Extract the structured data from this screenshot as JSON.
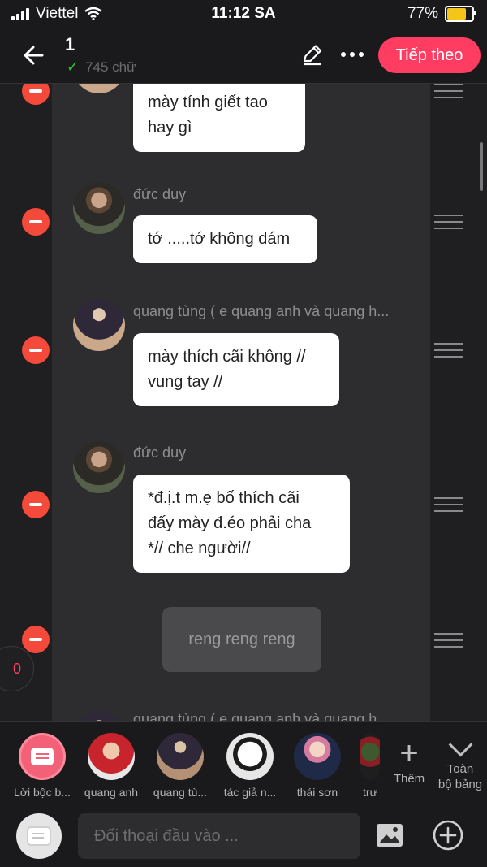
{
  "status_bar": {
    "carrier": "Viettel",
    "time": "11:12 SA",
    "battery": "77%",
    "battery_level": 0.77
  },
  "header": {
    "title": "1",
    "word_count": "745 chữ",
    "next_label": "Tiếp theo"
  },
  "messages": {
    "m1": {
      "lines": [
        "mày tính giết tao",
        "hay gì"
      ]
    },
    "m2": {
      "sender": "đức duy",
      "lines": [
        "tớ .....tớ không dám"
      ]
    },
    "m3": {
      "sender": "quang tùng ( e quang anh và quang h...",
      "lines": [
        "mày thích cãi không //",
        "vung tay //"
      ]
    },
    "m4": {
      "sender": "đức duy",
      "lines": [
        "*đ.ị.t m.ẹ bố thích cãi",
        "đấy mày đ.éo phải cha",
        "*// che người//"
      ]
    },
    "m5": {
      "narration": "reng reng reng"
    },
    "m6": {
      "sender": "quang tùng ( e quang anh và quang h..."
    }
  },
  "counter": "0",
  "characters": [
    {
      "label": "Lời bộc b..."
    },
    {
      "label": "quang anh"
    },
    {
      "label": "quang tù..."
    },
    {
      "label": "tác giả n..."
    },
    {
      "label": "thái sơn"
    },
    {
      "label": "trư"
    }
  ],
  "add_label": "Thêm",
  "collapse_label_line1": "Toàn",
  "collapse_label_line2": "bộ bảng",
  "input": {
    "placeholder": "Đối thoại đầu vào ..."
  },
  "colors": {
    "accent": "#ff3d63",
    "delete": "#f44a3c",
    "check": "#27c93f"
  }
}
